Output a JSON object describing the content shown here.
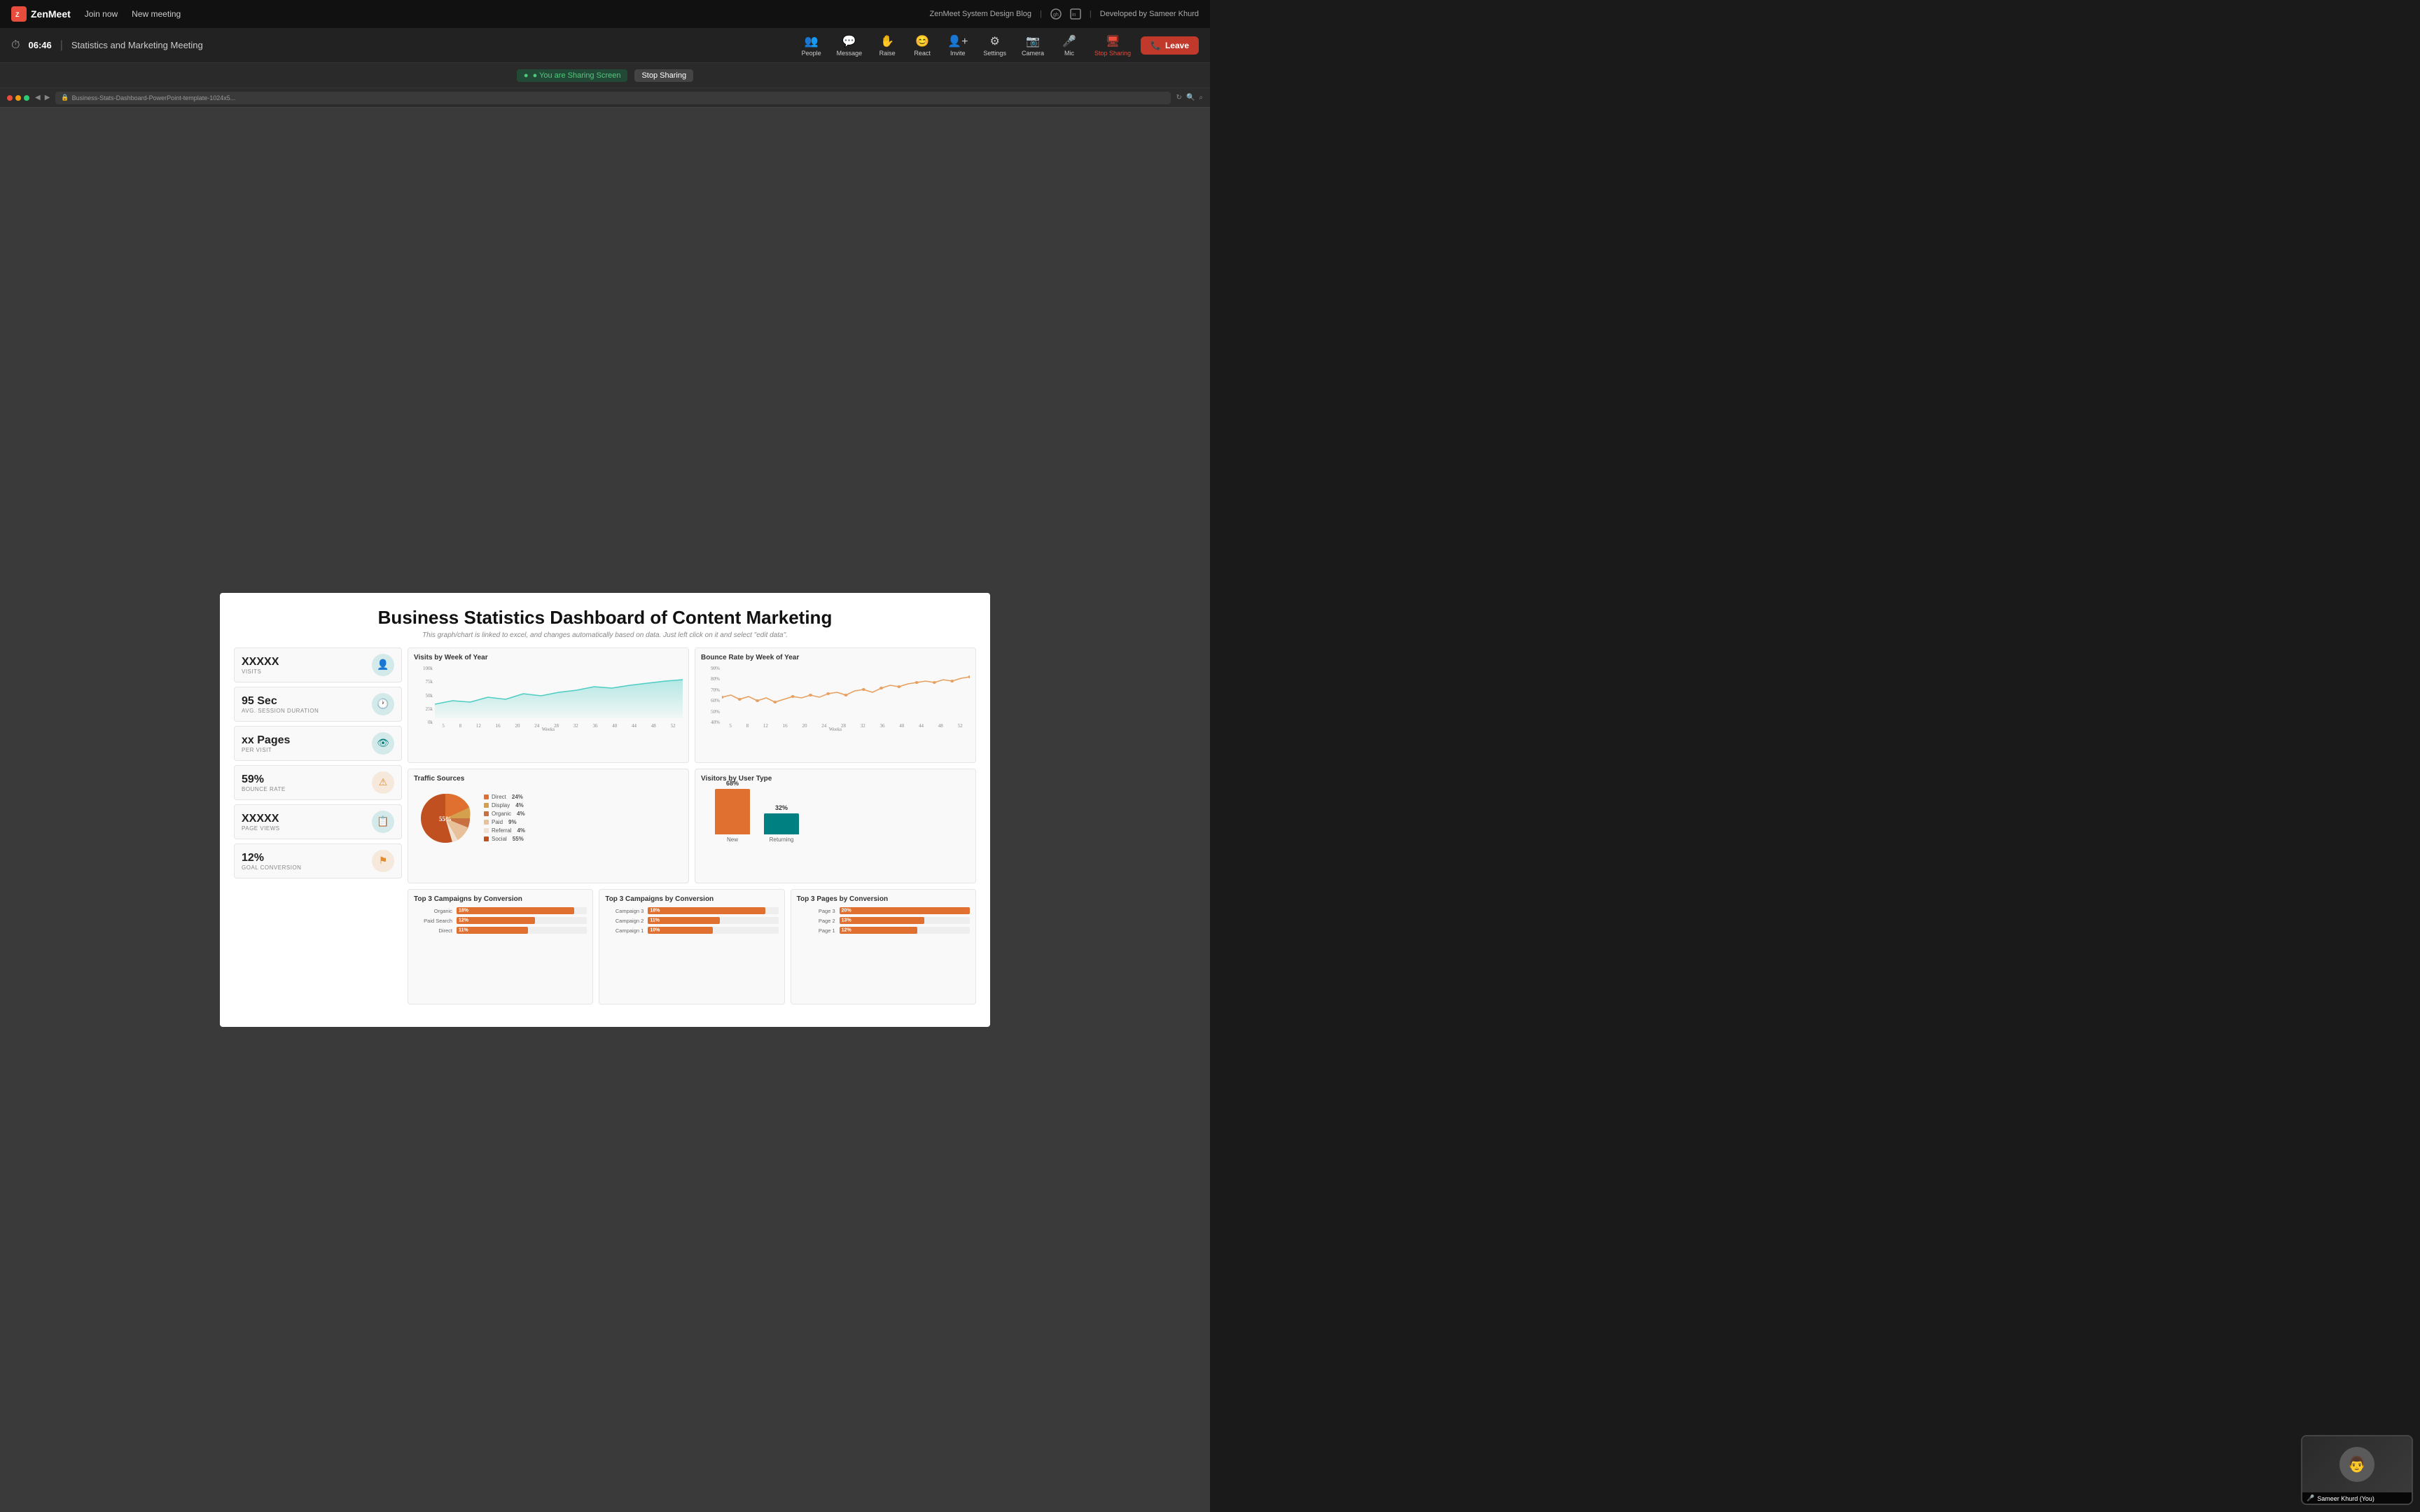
{
  "app": {
    "name": "ZenMeet",
    "logo_letter": "Z"
  },
  "nav": {
    "join_now": "Join now",
    "new_meeting": "New meeting",
    "right_links": [
      "ZenMeet System Design Blog",
      "Developed by Sameer Khurd"
    ]
  },
  "meeting": {
    "timer": "06:46",
    "title": "Statistics and Marketing Meeting"
  },
  "toolbar": {
    "people": "People",
    "message": "Message",
    "raise": "Raise",
    "react": "React",
    "invite": "Invite",
    "settings": "Settings",
    "camera": "Camera",
    "mic": "Mic",
    "stop_sharing": "Stop Sharing",
    "leave": "Leave"
  },
  "sharing": {
    "indicator": "● You are Sharing Screen",
    "stop_btn": "Stop Sharing"
  },
  "browser": {
    "url": "Business-Stats-Dashboard-PowerPoint-template-1024x5..."
  },
  "slide": {
    "title": "Business Statistics Dashboard of Content Marketing",
    "subtitle": "This graph/chart is linked to excel, and changes automatically based on data. Just left click on it and select \"edit data\".",
    "stats": [
      {
        "value": "XXXXX",
        "label": "VISITS",
        "icon": "👤",
        "icon_class": "teal"
      },
      {
        "value": "95 Sec",
        "label": "AVG. SESSION DURATION",
        "icon": "🕐",
        "icon_class": "teal"
      },
      {
        "value": "xx Pages",
        "label": "PER VISIT",
        "icon": "👁",
        "icon_class": "teal"
      },
      {
        "value": "59%",
        "label": "BOUNCE RATE",
        "icon": "⚠",
        "icon_class": "orange"
      },
      {
        "value": "XXXXX",
        "label": "PAGE VIEWS",
        "icon": "📋",
        "icon_class": "teal"
      },
      {
        "value": "12%",
        "label": "GOAL CONVERSION",
        "icon": "⚑",
        "icon_class": "orange"
      }
    ],
    "visits_chart": {
      "title": "Visits by Week of Year",
      "y_labels": [
        "100k",
        "75k",
        "50k",
        "25k",
        "0k"
      ],
      "x_label": "Weeks",
      "x_values": [
        "5",
        "8",
        "12",
        "16",
        "20",
        "24",
        "28",
        "32",
        "36",
        "40",
        "44",
        "48",
        "52"
      ]
    },
    "bounce_chart": {
      "title": "Bounce Rate by Week of Year",
      "y_labels": [
        "90%",
        "80%",
        "70%",
        "60%",
        "50%",
        "40%"
      ],
      "x_label": "Weeks",
      "x_values": [
        "5",
        "8",
        "12",
        "16",
        "20",
        "24",
        "28",
        "32",
        "36",
        "40",
        "44",
        "48",
        "52"
      ]
    },
    "traffic_sources": {
      "title": "Traffic Sources",
      "segments": [
        {
          "label": "Direct",
          "pct": 24,
          "color": "#e07030"
        },
        {
          "label": "Display",
          "pct": 4,
          "color": "#d4a04e"
        },
        {
          "label": "Organic",
          "pct": 4,
          "color": "#c87040"
        },
        {
          "label": "Paid",
          "pct": 9,
          "color": "#e8c09a"
        },
        {
          "label": "Referral",
          "pct": 4,
          "color": "#f0e0d0"
        },
        {
          "label": "Social",
          "pct": 55,
          "color": "#c05020"
        }
      ]
    },
    "user_type": {
      "title": "Visitors by User Type",
      "new_pct": 68,
      "returning_pct": 32,
      "new_label": "New",
      "returning_label": "Returning",
      "new_color": "#e07030",
      "returning_color": "#008080"
    },
    "campaigns1": {
      "title": "Top 3 Campaigns by Conversion",
      "rows": [
        {
          "label": "Organic",
          "pct": 18,
          "color": "#e07030"
        },
        {
          "label": "Paid Search",
          "pct": 12,
          "color": "#e07030"
        },
        {
          "label": "Direct",
          "pct": 11,
          "color": "#e07030"
        }
      ]
    },
    "campaigns2": {
      "title": "Top 3 Campaigns by Conversion",
      "rows": [
        {
          "label": "Campaign 3",
          "pct": 18,
          "color": "#e07030"
        },
        {
          "label": "Campaign 2",
          "pct": 11,
          "color": "#e07030"
        },
        {
          "label": "Campaign 1",
          "pct": 10,
          "color": "#e07030"
        }
      ]
    },
    "pages": {
      "title": "Top 3 Pages by Conversion",
      "rows": [
        {
          "label": "Page 3",
          "pct": 20,
          "color": "#e07030"
        },
        {
          "label": "Page 2",
          "pct": 13,
          "color": "#e07030"
        },
        {
          "label": "Page 1",
          "pct": 12,
          "color": "#e07030"
        }
      ]
    }
  },
  "self_video": {
    "name": "Sameer Khurd (You)"
  }
}
